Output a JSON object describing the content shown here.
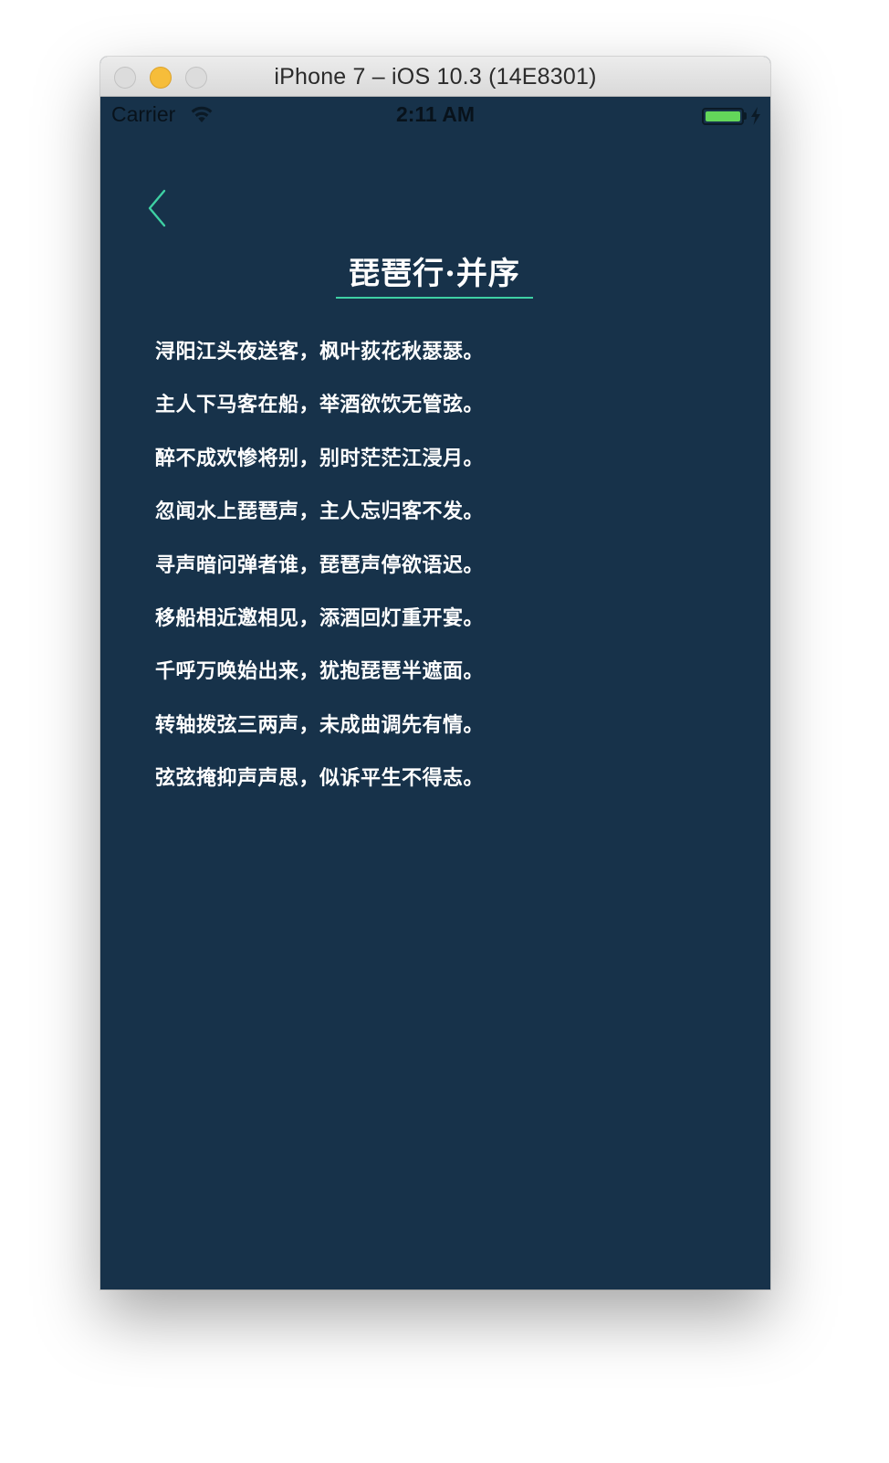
{
  "window": {
    "title": "iPhone 7 – iOS 10.3 (14E8301)"
  },
  "status_bar": {
    "carrier": "Carrier",
    "time": "2:11 AM",
    "battery_level": 1.0,
    "charging": true
  },
  "navigation": {
    "back_icon": "chevron-left-icon"
  },
  "poem": {
    "title": "琵琶行·并序",
    "lines": [
      "浔阳江头夜送客，枫叶荻花秋瑟瑟。",
      "主人下马客在船，举酒欲饮无管弦。",
      "醉不成欢惨将别，别时茫茫江浸月。",
      "忽闻水上琵琶声，主人忘归客不发。",
      "寻声暗问弹者谁，琵琶声停欲语迟。",
      "移船相近邀相见，添酒回灯重开宴。",
      "千呼万唤始出来，犹抱琵琶半遮面。",
      "转轴拨弦三两声，未成曲调先有情。",
      "弦弦掩抑声声思，似诉平生不得志。"
    ]
  },
  "colors": {
    "background": "#17324a",
    "accent": "#3ed0a3",
    "text": "#ffffff",
    "battery": "#63d65a"
  }
}
